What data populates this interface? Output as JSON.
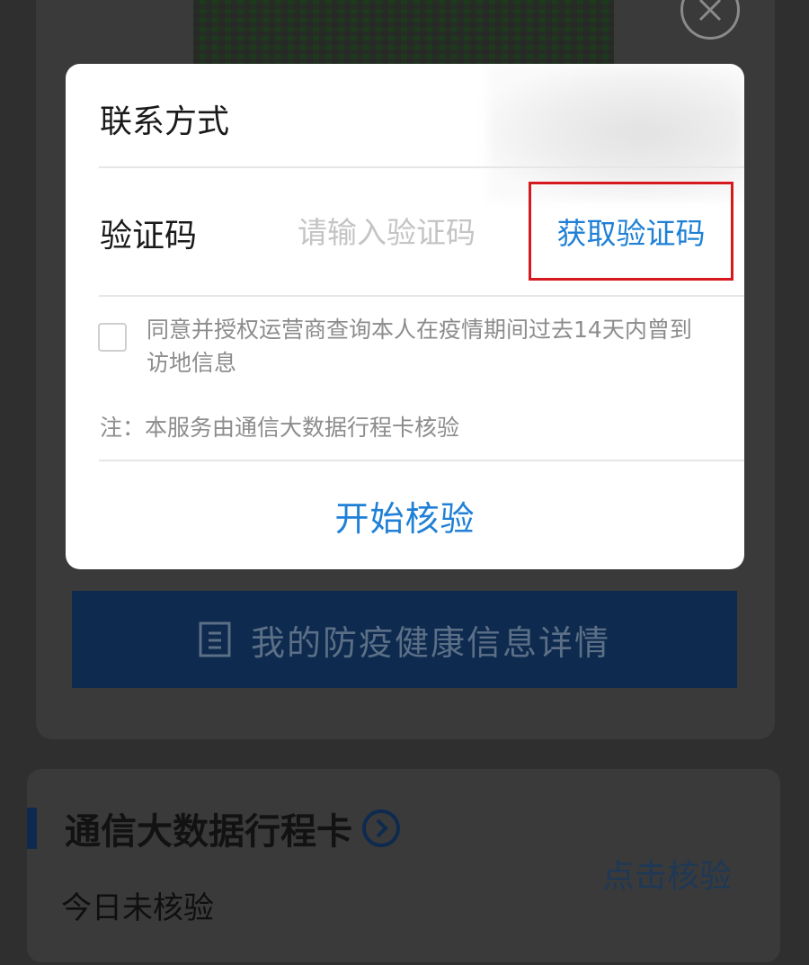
{
  "modal": {
    "contact_label": "联系方式",
    "code_label": "验证码",
    "code_placeholder": "请输入验证码",
    "get_code_label": "获取验证码",
    "consent_text": "同意并授权运营商查询本人在疫情期间过去14天内曾到访地信息",
    "note_text": "注：本服务由通信大数据行程卡核验",
    "start_label": "开始核验"
  },
  "background": {
    "health_button_label": "我的防疫健康信息详情",
    "trip_card_title": "通信大数据行程卡",
    "trip_status": "今日未核验",
    "trip_action_label": "点击核验"
  },
  "icons": {
    "close": "close-icon",
    "document": "document-icon",
    "chevron": "chevron-right-circle-icon"
  },
  "colors": {
    "accent_blue": "#1f80d6",
    "highlight_red": "#d7191f",
    "dark_navy": "#0e2a4e"
  }
}
